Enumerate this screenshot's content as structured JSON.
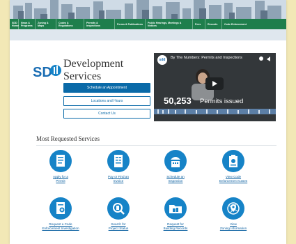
{
  "header": {
    "nav_items": [
      {
        "label": "SDD Home"
      },
      {
        "label": "News & Programs"
      },
      {
        "label": "Zoning & Maps"
      },
      {
        "label": "Codes & Regulations"
      },
      {
        "label": "Permits & Inspections"
      },
      {
        "label": "Forms & Publications"
      },
      {
        "label": "Public Hearings, Meetings & Notices"
      },
      {
        "label": "Fees"
      },
      {
        "label": "Records"
      },
      {
        "label": "Code Enforcement"
      }
    ]
  },
  "brand": {
    "logo_text": "SD",
    "title_line1": "Development",
    "title_line2": "Services"
  },
  "actions": {
    "schedule": "Schedule an Appointment",
    "locations": "Locations and Hours",
    "contact": "Contact Us"
  },
  "video": {
    "channel_logo": "sdd",
    "title": "By The Numbers: Permits and Inspections",
    "number": "50,253",
    "caption": "Permits issued"
  },
  "services_section": {
    "title": "Most Requested Services",
    "items": [
      {
        "line1": "Apply for a",
        "line2": "Permit",
        "icon": "document-icon"
      },
      {
        "line1": "Pay or Find an",
        "line2": "Invoice",
        "icon": "invoice-icon"
      },
      {
        "line1": "Schedule an",
        "line2": "Inspection",
        "icon": "calendar-helmet-icon"
      },
      {
        "line1": "View Code",
        "line2": "Enforcement Cases",
        "icon": "clipboard-icon"
      },
      {
        "line1": "Request a Code",
        "line2": "Enforcement Investigation",
        "icon": "request-form-icon"
      },
      {
        "line1": "Search for",
        "line2": "Project Status",
        "icon": "search-building-icon"
      },
      {
        "line1": "Request for",
        "line2": "Building Records",
        "icon": "folder-icon"
      },
      {
        "line1": "View",
        "line2": "Zoning Information",
        "icon": "map-pin-icon"
      }
    ]
  },
  "colors": {
    "nav_green": "#1e7e4c",
    "primary_blue": "#0a6aa8",
    "icon_blue": "#1683c7",
    "page_bg": "#f2e8b6"
  }
}
